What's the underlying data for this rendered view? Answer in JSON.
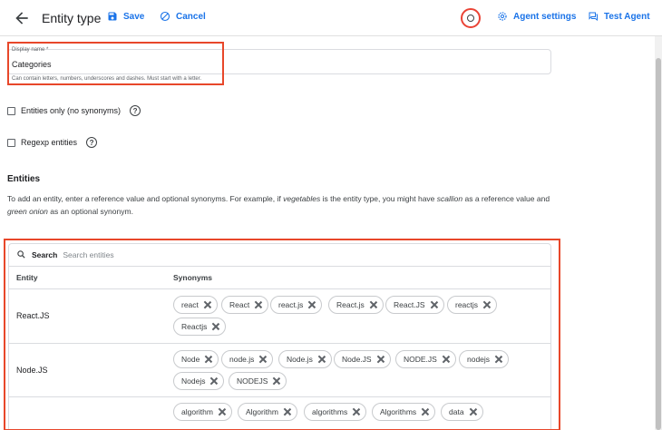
{
  "topbar": {
    "title": "Entity type",
    "save_label": "Save",
    "cancel_label": "Cancel",
    "agent_settings_label": "Agent settings",
    "test_agent_label": "Test Agent"
  },
  "display_name": {
    "label": "Display name *",
    "value": "Categories",
    "helper": "Can contain letters, numbers, underscores and dashes. Must start with a letter."
  },
  "options": {
    "entities_only_label": "Entities only (no synonyms)",
    "regexp_label": "Regexp entities",
    "help_glyph": "?"
  },
  "entities_section": {
    "heading": "Entities",
    "desc_part1": "To add an entity, enter a reference value and optional synonyms. For example, if ",
    "desc_em1": "vegetables",
    "desc_part2": " is the entity type, you might have ",
    "desc_em2": "scallion",
    "desc_part3": " as a reference value and ",
    "desc_em3": "green onion",
    "desc_part4": " as an optional synonym."
  },
  "table": {
    "search_label": "Search",
    "search_placeholder": "Search entities",
    "col_entity": "Entity",
    "col_synonyms": "Synonyms",
    "rows": [
      {
        "entity": "React.JS",
        "synonyms": [
          "react",
          "React",
          "react.js",
          "React.js",
          "React.JS",
          "reactjs",
          "Reactjs"
        ]
      },
      {
        "entity": "Node.JS",
        "synonyms": [
          "Node",
          "node.js",
          "Node.js",
          "Node.JS",
          "NODE.JS",
          "nodejs",
          "Nodejs",
          "NODEJS"
        ]
      },
      {
        "entity": "",
        "synonyms": [
          "algorithm",
          "Algorithm",
          "algorithms",
          "Algorithms",
          "data"
        ]
      }
    ]
  },
  "colors": {
    "accent": "#1a73e8",
    "highlight": "#e8472a"
  }
}
